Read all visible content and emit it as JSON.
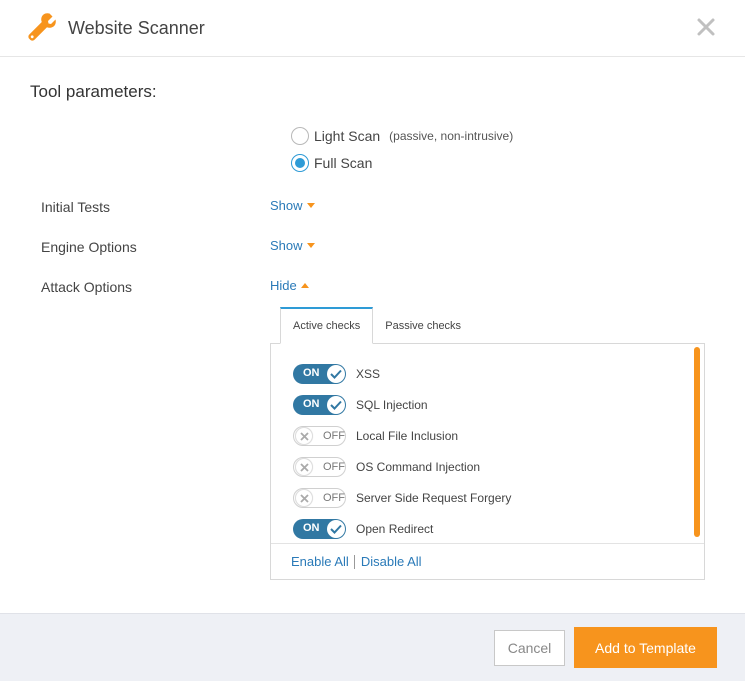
{
  "dialog": {
    "title": "Website Scanner",
    "close_icon": "close-icon",
    "title_icon": "wrench-icon",
    "accent_color": "#f7941d",
    "link_color": "#2a7ab8"
  },
  "tool_parameters": {
    "heading": "Tool parameters:",
    "scan_types": [
      {
        "label": "Light Scan",
        "sublabel": "(passive, non-intrusive)",
        "checked": false
      },
      {
        "label": "Full Scan",
        "sublabel": "",
        "checked": true
      }
    ],
    "options": [
      {
        "label": "Initial Tests",
        "link": "Show",
        "expanded": false
      },
      {
        "label": "Engine Options",
        "link": "Show",
        "expanded": false
      },
      {
        "label": "Attack Options",
        "link": "Hide",
        "expanded": true
      }
    ]
  },
  "attack_options": {
    "tabs": [
      {
        "label": "Active checks",
        "active": true
      },
      {
        "label": "Passive checks",
        "active": false
      }
    ],
    "toggle_on_label": "ON",
    "toggle_off_label": "OFF",
    "checks": [
      {
        "name": "XSS",
        "enabled": true
      },
      {
        "name": "SQL Injection",
        "enabled": true
      },
      {
        "name": "Local File Inclusion",
        "enabled": false
      },
      {
        "name": "OS Command Injection",
        "enabled": false
      },
      {
        "name": "Server Side Request Forgery",
        "enabled": false
      },
      {
        "name": "Open Redirect",
        "enabled": true
      }
    ],
    "enable_all": "Enable All",
    "disable_all": "Disable All"
  },
  "footer": {
    "cancel_label": "Cancel",
    "add_label": "Add to Template"
  }
}
